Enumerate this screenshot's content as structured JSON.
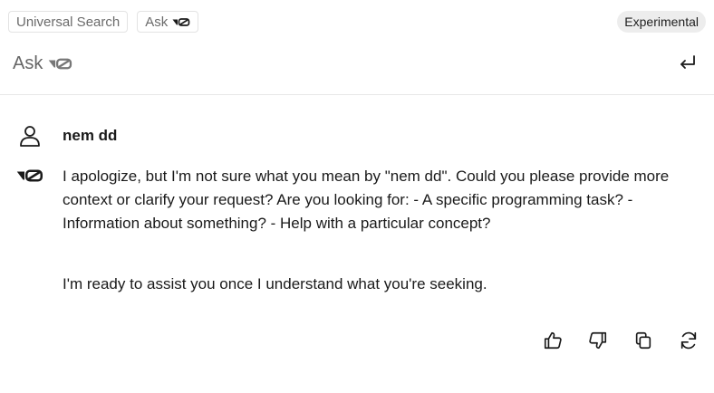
{
  "tabs": {
    "universal_search": "Universal Search",
    "ask": "Ask"
  },
  "badge": "Experimental",
  "header": {
    "title": "Ask"
  },
  "conversation": {
    "user_message": "nem dd",
    "assistant_paragraph_1": "I apologize, but I'm not sure what you mean by \"nem dd\". Could you please provide more context or clarify your request? Are you looking for: - A specific programming task? - Information about something? - Help with a particular concept?",
    "assistant_paragraph_2": "I'm ready to assist you once I understand what you're seeking."
  },
  "icons": {
    "logo": "v0-logo-icon",
    "enter": "enter-return-icon",
    "user": "user-icon",
    "thumbs_up": "thumbs-up-icon",
    "thumbs_down": "thumbs-down-icon",
    "copy": "copy-icon",
    "regenerate": "refresh-icon"
  }
}
